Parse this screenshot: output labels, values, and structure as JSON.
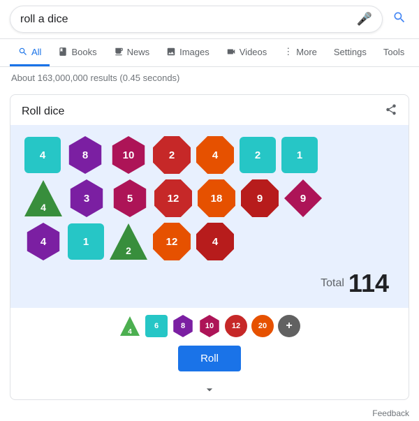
{
  "search": {
    "query": "roll a dice",
    "placeholder": "roll a dice"
  },
  "nav": {
    "tabs": [
      {
        "id": "all",
        "label": "All",
        "icon": "🔍",
        "active": true
      },
      {
        "id": "books",
        "label": "Books",
        "icon": "📖",
        "active": false
      },
      {
        "id": "news",
        "label": "News",
        "icon": "📰",
        "active": false
      },
      {
        "id": "images",
        "label": "Images",
        "icon": "🖼",
        "active": false
      },
      {
        "id": "videos",
        "label": "Videos",
        "icon": "▶",
        "active": false
      },
      {
        "id": "more",
        "label": "More",
        "icon": "⋮",
        "active": false
      }
    ],
    "settings": "Settings",
    "tools": "Tools"
  },
  "results": {
    "count_text": "About 163,000,000 results (0.45 seconds)"
  },
  "widget": {
    "title": "Roll dice",
    "total_label": "Total",
    "total_value": "114",
    "roll_button": "Roll",
    "expand_icon": "⌄",
    "feedback": "Feedback",
    "dice_rows": [
      [
        {
          "shape": "square",
          "color": "teal",
          "value": "4"
        },
        {
          "shape": "hex",
          "color": "purple",
          "value": "8"
        },
        {
          "shape": "hex",
          "color": "magenta",
          "value": "10"
        },
        {
          "shape": "oct",
          "color": "red",
          "value": "2"
        },
        {
          "shape": "oct",
          "color": "orange",
          "value": "4"
        },
        {
          "shape": "square",
          "color": "teal",
          "value": "2"
        },
        {
          "shape": "square",
          "color": "teal",
          "value": "1"
        }
      ],
      [
        {
          "shape": "tri",
          "color": "green",
          "value": "4"
        },
        {
          "shape": "hex",
          "color": "purple",
          "value": "3"
        },
        {
          "shape": "hex",
          "color": "magenta",
          "value": "5"
        },
        {
          "shape": "oct",
          "color": "red",
          "value": "12"
        },
        {
          "shape": "oct",
          "color": "orange",
          "value": "18"
        },
        {
          "shape": "oct",
          "color": "darkred",
          "value": "9"
        },
        {
          "shape": "diamond",
          "color": "magenta",
          "value": "9"
        }
      ],
      [
        {
          "shape": "hex",
          "color": "purple",
          "value": "4"
        },
        {
          "shape": "square",
          "color": "teal",
          "value": "1"
        },
        {
          "shape": "tri",
          "color": "green",
          "value": "2"
        },
        {
          "shape": "oct",
          "color": "orange",
          "value": "12"
        },
        {
          "shape": "oct",
          "color": "darkred",
          "value": "4"
        }
      ]
    ],
    "selector_dice": [
      {
        "label": "4",
        "color": "green",
        "shape": "tri"
      },
      {
        "label": "6",
        "color": "teal",
        "shape": "square"
      },
      {
        "label": "8",
        "color": "purple",
        "shape": "hex"
      },
      {
        "label": "10",
        "color": "magenta",
        "shape": "hex"
      },
      {
        "label": "12",
        "color": "red",
        "shape": "oct"
      },
      {
        "label": "20",
        "color": "orange",
        "shape": "oct"
      },
      {
        "label": "+",
        "color": "gray",
        "shape": "circle"
      }
    ]
  }
}
